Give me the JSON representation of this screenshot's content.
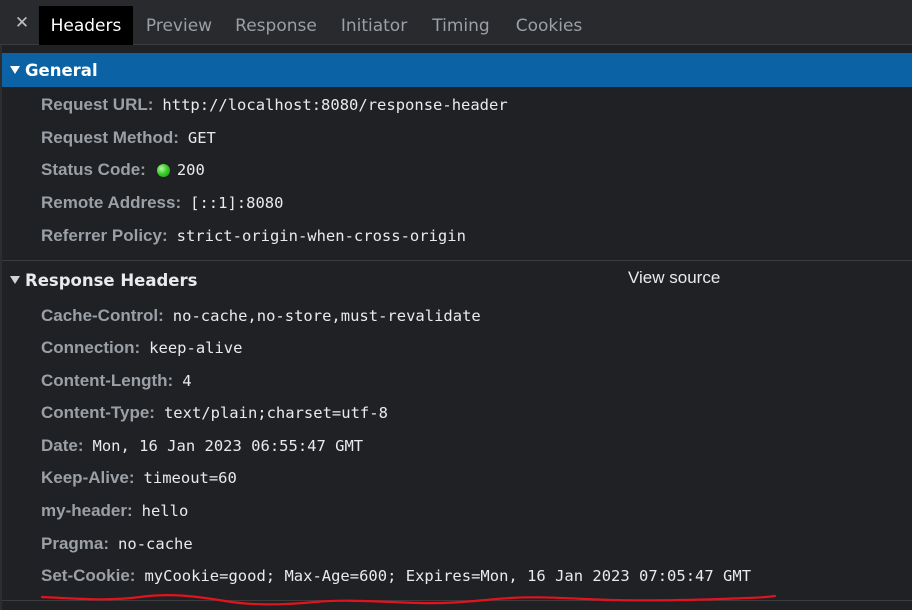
{
  "tabs": {
    "close_icon": "close-icon",
    "items": [
      {
        "label": "Headers",
        "active": true
      },
      {
        "label": "Preview",
        "active": false
      },
      {
        "label": "Response",
        "active": false
      },
      {
        "label": "Initiator",
        "active": false
      },
      {
        "label": "Timing",
        "active": false
      },
      {
        "label": "Cookies",
        "active": false
      }
    ]
  },
  "general": {
    "title": "General",
    "rows": [
      {
        "key": "Request URL:",
        "value": "http://localhost:8080/response-header"
      },
      {
        "key": "Request Method:",
        "value": "GET"
      },
      {
        "key": "Status Code:",
        "value": "200"
      },
      {
        "key": "Remote Address:",
        "value": "[::1]:8080"
      },
      {
        "key": "Referrer Policy:",
        "value": "strict-origin-when-cross-origin"
      }
    ]
  },
  "response_headers": {
    "title": "Response Headers",
    "view_source": "View source",
    "rows": [
      {
        "key": "Cache-Control:",
        "value": "no-cache,no-store,must-revalidate"
      },
      {
        "key": "Connection:",
        "value": "keep-alive"
      },
      {
        "key": "Content-Length:",
        "value": "4"
      },
      {
        "key": "Content-Type:",
        "value": "text/plain;charset=utf-8"
      },
      {
        "key": "Date:",
        "value": "Mon, 16 Jan 2023 06:55:47 GMT"
      },
      {
        "key": "Keep-Alive:",
        "value": "timeout=60"
      },
      {
        "key": "my-header:",
        "value": "hello"
      },
      {
        "key": "Pragma:",
        "value": "no-cache"
      },
      {
        "key": "Set-Cookie:",
        "value": "myCookie=good; Max-Age=600; Expires=Mon, 16 Jan 2023 07:05:47 GMT"
      }
    ]
  },
  "colors": {
    "background": "#202124",
    "selected_section": "#0b62a5",
    "key_text": "#9aa0a6",
    "value_text": "#e8eaed",
    "status_ok": "#3ccf2c",
    "annotation_underline": "#e0141e"
  }
}
